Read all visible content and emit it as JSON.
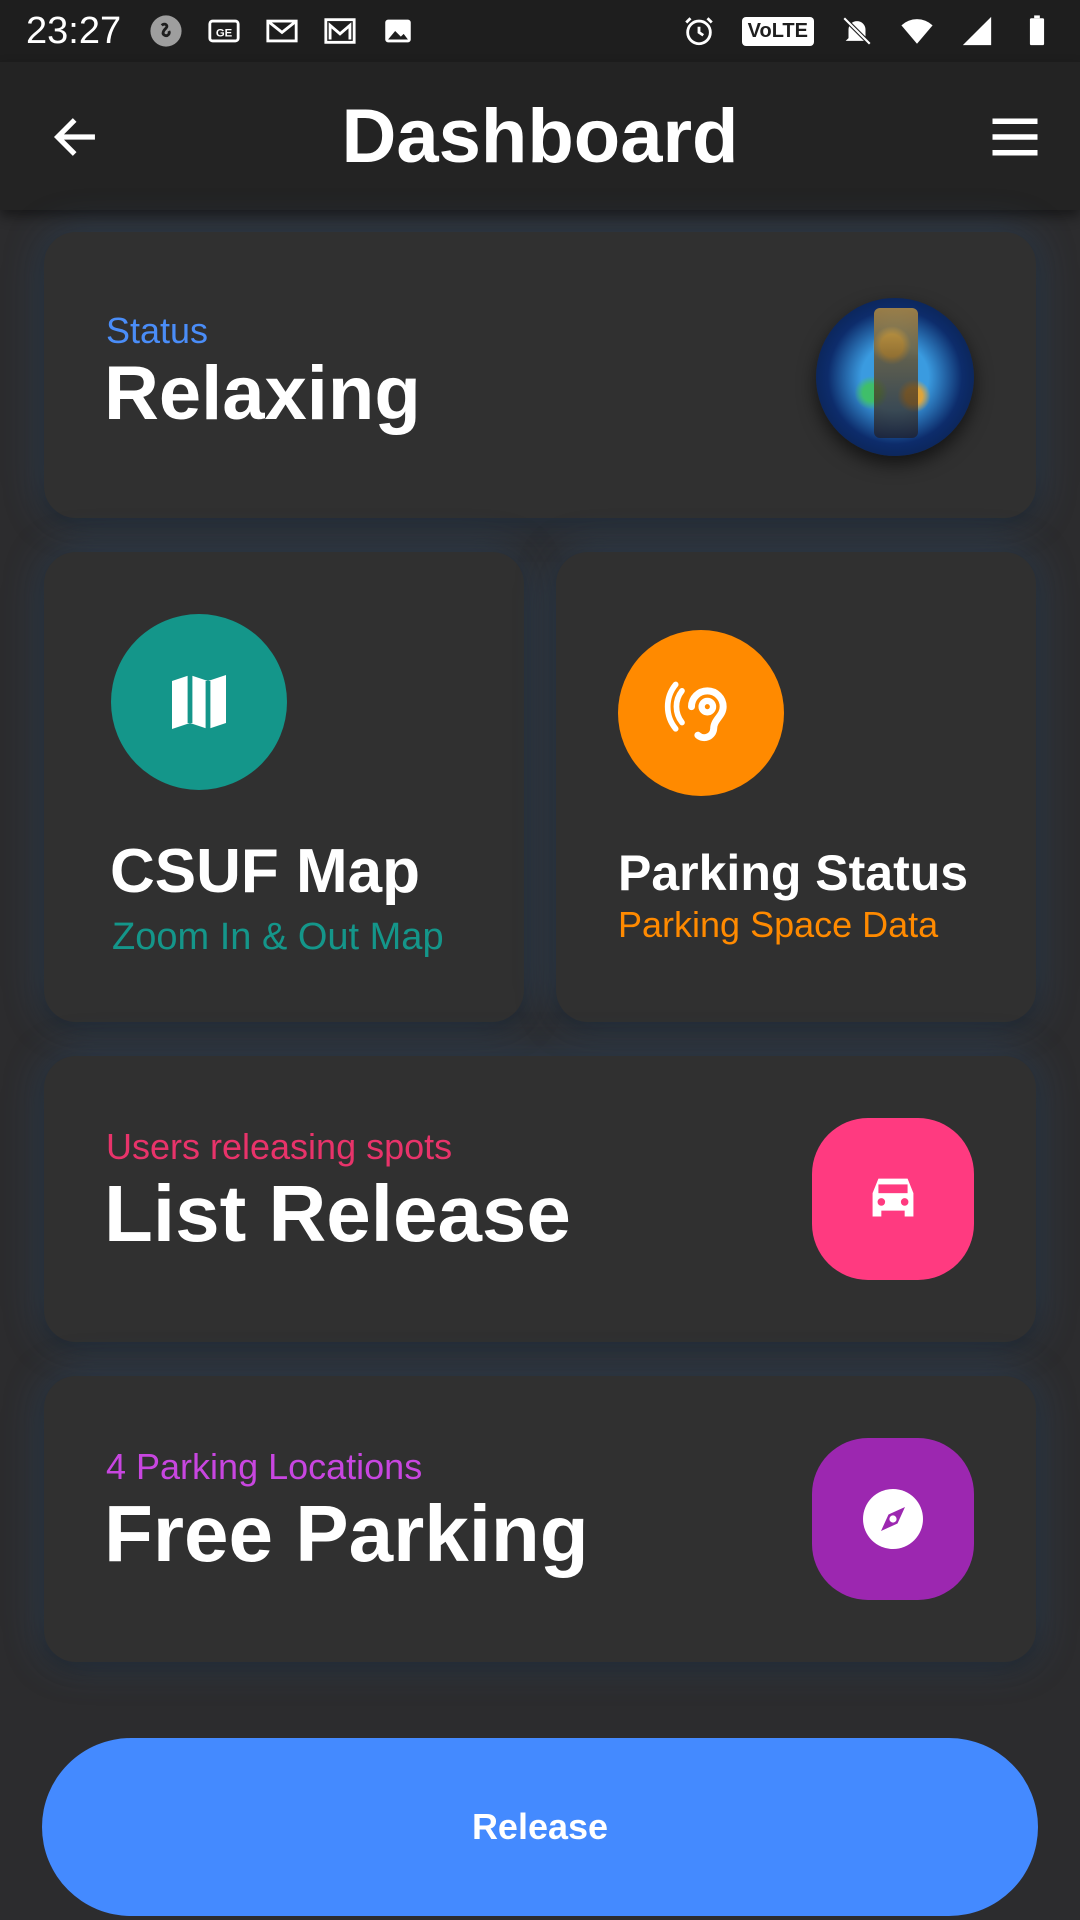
{
  "status_bar": {
    "time": "23:27",
    "left_icons": [
      "shazam-icon",
      "ge-icon",
      "gmail-icon",
      "gmail-outline-icon",
      "image-icon"
    ],
    "volte": "VoLTE",
    "right_icons": [
      "alarm-icon",
      "volte-icon",
      "bell-off-icon",
      "wifi-icon",
      "signal-icon",
      "battery-icon"
    ]
  },
  "app_bar": {
    "title": "Dashboard",
    "back_icon": "arrow-left-icon",
    "menu_icon": "hamburger-menu-icon"
  },
  "status_card": {
    "kicker": "Status",
    "headline": "Relaxing",
    "avatar": "profile-avatar"
  },
  "map_card": {
    "icon": "map-icon",
    "title": "CSUF Map",
    "subtitle": "Zoom In & Out Map",
    "accent": "#14968a"
  },
  "parking_card": {
    "icon": "hearing-icon",
    "title": "Parking Status",
    "subtitle": "Parking Space Data",
    "accent": "#ff8a00"
  },
  "release_card": {
    "kicker": "Users releasing spots",
    "headline": "List Release",
    "icon": "car-icon",
    "accent": "#ff3a80"
  },
  "free_card": {
    "kicker": "4 Parking Locations",
    "headline": "Free Parking",
    "icon": "compass-icon",
    "accent": "#9c27b0"
  },
  "release_button": {
    "label": "Release",
    "color": "#448aff"
  }
}
